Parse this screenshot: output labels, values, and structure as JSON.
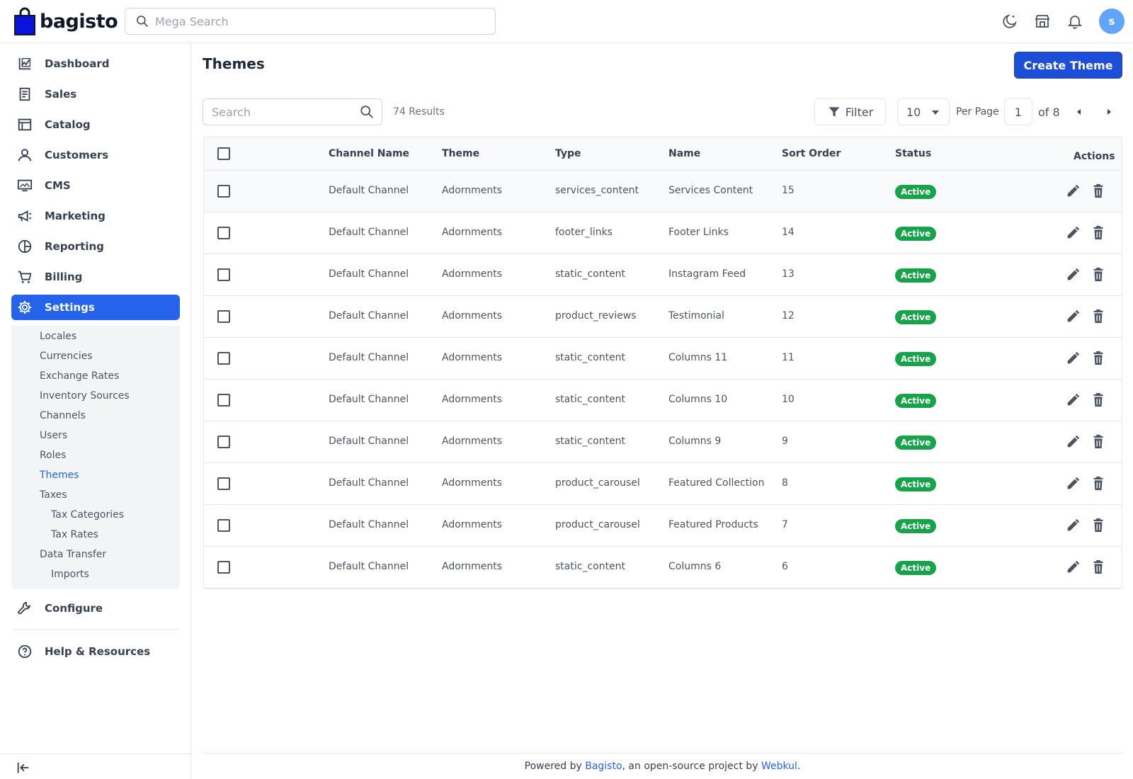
{
  "brand": {
    "name": "bagisto",
    "accent": "#2563eb"
  },
  "header": {
    "search_placeholder": "Mega Search",
    "icons": [
      "dark-mode-icon",
      "storefront-icon",
      "notification-bell-icon"
    ],
    "avatar_initial": "s"
  },
  "sidebar": {
    "items": [
      {
        "label": "Dashboard",
        "icon": "dashboard-icon"
      },
      {
        "label": "Sales",
        "icon": "receipt-icon"
      },
      {
        "label": "Catalog",
        "icon": "catalog-icon"
      },
      {
        "label": "Customers",
        "icon": "user-icon"
      },
      {
        "label": "CMS",
        "icon": "monitor-icon"
      },
      {
        "label": "Marketing",
        "icon": "megaphone-icon"
      },
      {
        "label": "Reporting",
        "icon": "pie-chart-icon"
      },
      {
        "label": "Billing",
        "icon": "cart-icon"
      },
      {
        "label": "Settings",
        "icon": "gear-icon",
        "active": true
      }
    ],
    "settings_sub": [
      "Locales",
      "Currencies",
      "Exchange Rates",
      "Inventory Sources",
      "Channels",
      "Users",
      "Roles",
      "Themes",
      "Taxes",
      "Tax Categories",
      "Tax Rates",
      "Data Transfer",
      "Imports"
    ],
    "active_sub": "Themes",
    "configure": "Configure",
    "help": "Help & Resources"
  },
  "page": {
    "title": "Themes",
    "create_button": "Create Theme",
    "search_placeholder": "Search",
    "results": "74 Results",
    "filter_label": "Filter",
    "per_page_value": "10",
    "per_page_label": "Per Page",
    "current_page": "1",
    "of_pages": "of 8"
  },
  "table": {
    "columns": [
      "Channel Name",
      "Theme",
      "Type",
      "Name",
      "Sort Order",
      "Status",
      "Actions"
    ],
    "rows": [
      {
        "channel": "Default Channel",
        "theme": "Adornments",
        "type": "services_content",
        "name": "Services Content",
        "sort": "15",
        "status": "Active"
      },
      {
        "channel": "Default Channel",
        "theme": "Adornments",
        "type": "footer_links",
        "name": "Footer Links",
        "sort": "14",
        "status": "Active"
      },
      {
        "channel": "Default Channel",
        "theme": "Adornments",
        "type": "static_content",
        "name": "Instagram Feed",
        "sort": "13",
        "status": "Active"
      },
      {
        "channel": "Default Channel",
        "theme": "Adornments",
        "type": "product_reviews",
        "name": "Testimonial",
        "sort": "12",
        "status": "Active"
      },
      {
        "channel": "Default Channel",
        "theme": "Adornments",
        "type": "static_content",
        "name": "Columns 11",
        "sort": "11",
        "status": "Active"
      },
      {
        "channel": "Default Channel",
        "theme": "Adornments",
        "type": "static_content",
        "name": "Columns 10",
        "sort": "10",
        "status": "Active"
      },
      {
        "channel": "Default Channel",
        "theme": "Adornments",
        "type": "static_content",
        "name": "Columns 9",
        "sort": "9",
        "status": "Active"
      },
      {
        "channel": "Default Channel",
        "theme": "Adornments",
        "type": "product_carousel",
        "name": "Featured Collection",
        "sort": "8",
        "status": "Active"
      },
      {
        "channel": "Default Channel",
        "theme": "Adornments",
        "type": "product_carousel",
        "name": "Featured Products",
        "sort": "7",
        "status": "Active"
      },
      {
        "channel": "Default Channel",
        "theme": "Adornments",
        "type": "static_content",
        "name": "Columns 6",
        "sort": "6",
        "status": "Active"
      }
    ],
    "status_color": "#16a34a"
  },
  "footer": {
    "prefix": "Powered by ",
    "link1": "Bagisto",
    "middle": ", an open-source project by ",
    "link2": "Webkul",
    "suffix": "."
  }
}
